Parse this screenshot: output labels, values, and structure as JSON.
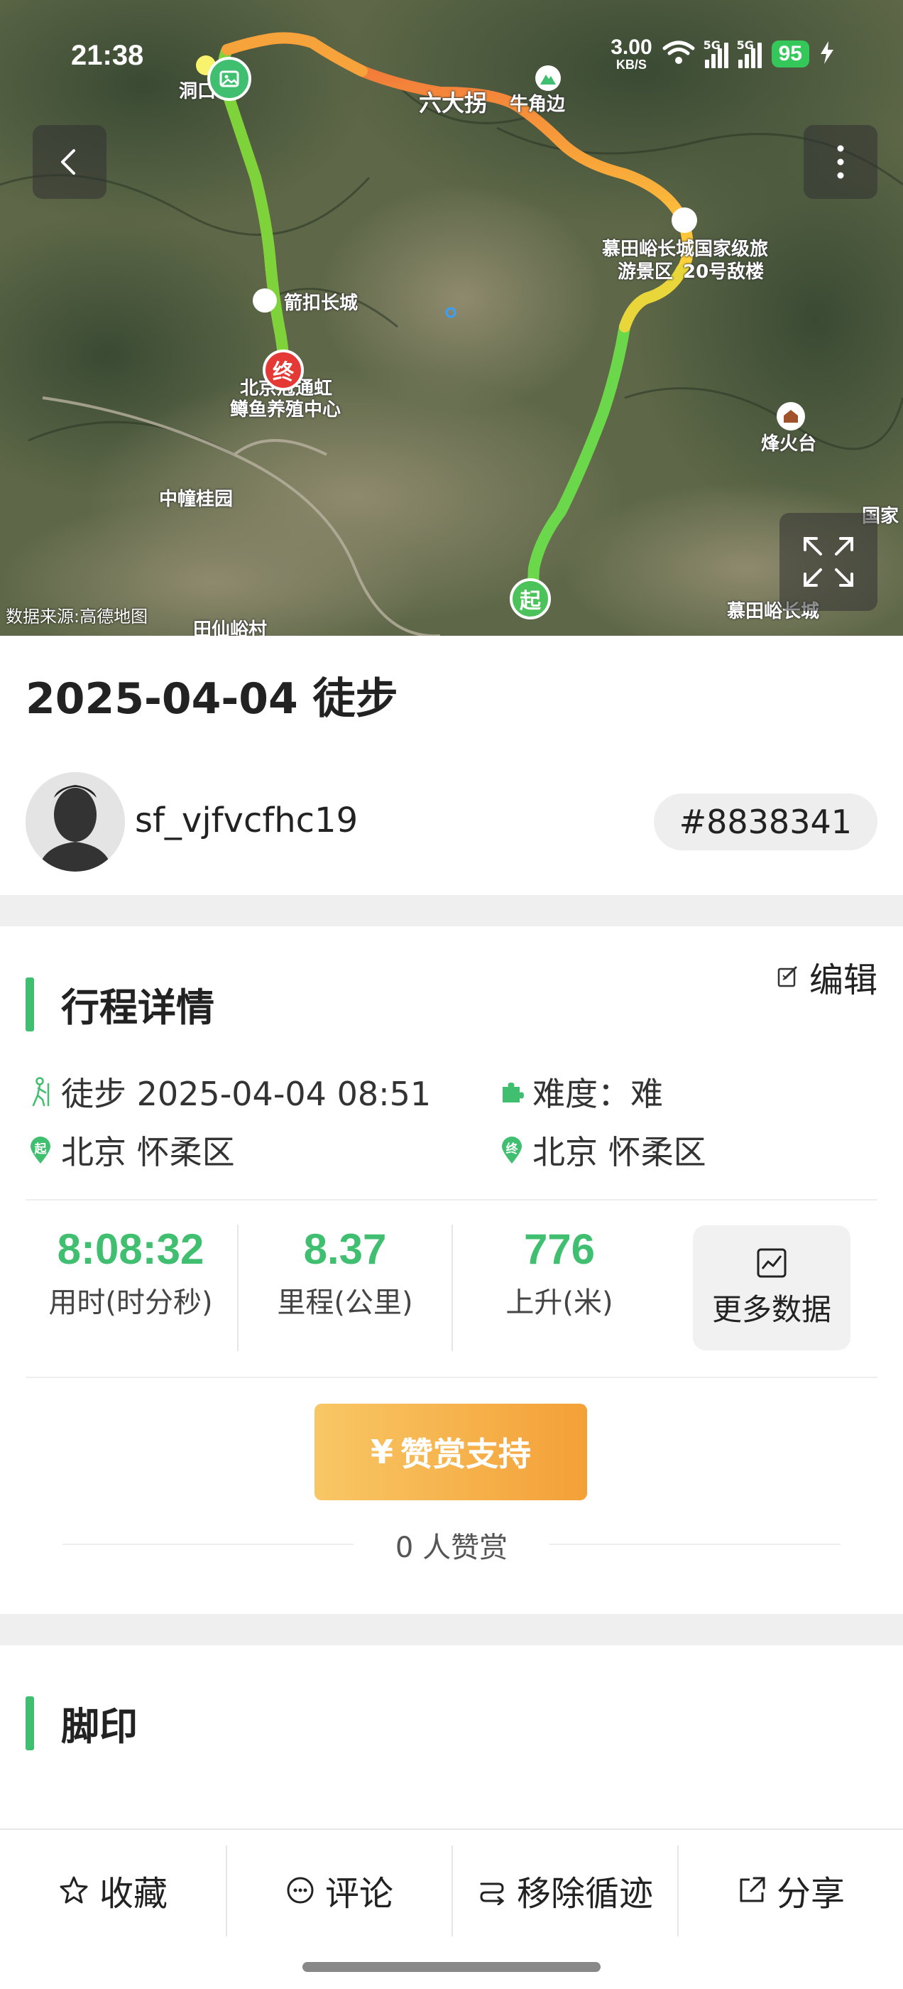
{
  "status_bar": {
    "time": "21:38",
    "net_speed_value": "3.00",
    "net_speed_unit": "KB/S",
    "signal1_tag": "5G",
    "signal2_tag": "5G",
    "battery": "95"
  },
  "map": {
    "source": "数据来源:高德地图",
    "labels": {
      "dongkou": "洞口",
      "liuguai": "六大拐",
      "niujiao": "牛角边",
      "mutianyu": "慕田峪长城国家级旅",
      "mutianyu2": "游景区",
      "tower": "20号敌楼",
      "jiankou": "箭扣长城",
      "endpoint": "北京冠通虹",
      "endpoint2": "鳟鱼养殖中心",
      "zhongzhen": "中幢桂园",
      "fenghuo": "烽火台",
      "tianxian": "田仙峪村",
      "guojia": "国家",
      "mutianyu_br": "慕田峪长城"
    },
    "start_marker": "起",
    "end_marker": "终"
  },
  "header": {
    "title": "2025-04-04 徒步",
    "username": "sf_vjfvcfhc19",
    "trip_id": "#8838341"
  },
  "trip": {
    "section_title": "行程详情",
    "edit_label": "编辑",
    "activity": "徒步 2025-04-04 08:51",
    "difficulty": "难度：难",
    "start_location": "北京 怀柔区",
    "end_location": "北京 怀柔区",
    "start_badge": "起",
    "end_badge": "终",
    "stats": [
      {
        "value": "8:08:32",
        "label": "用时(时分秒)"
      },
      {
        "value": "8.37",
        "label": "里程(公里)"
      },
      {
        "value": "776",
        "label": "上升(米)"
      }
    ],
    "more_data_label": "更多数据",
    "reward_button": "赞赏支持",
    "reward_symbol": "¥",
    "reward_count": "0 人赞赏"
  },
  "footprint": {
    "section_title": "脚印"
  },
  "bottom_bar": {
    "favorite": "收藏",
    "comment": "评论",
    "remove": "移除循迹",
    "share": "分享"
  }
}
